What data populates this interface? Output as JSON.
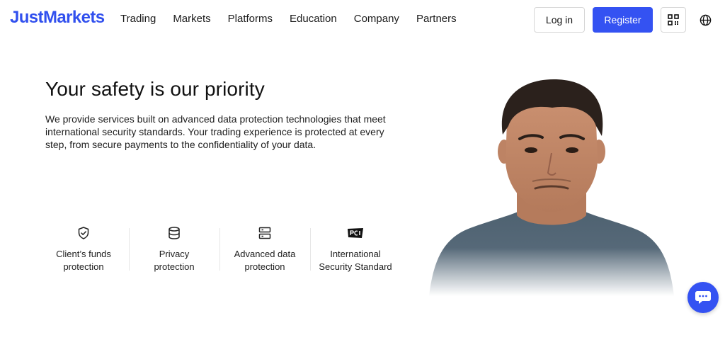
{
  "header": {
    "logo": "JustMarkets",
    "nav": [
      "Trading",
      "Markets",
      "Platforms",
      "Education",
      "Company",
      "Partners"
    ],
    "login_label": "Log in",
    "register_label": "Register",
    "brand_color": "#3452f2"
  },
  "hero": {
    "title": "Your safety is our priority",
    "description": "We provide services built on advanced data protection technologies that meet international security standards. Your trading experience is protected at every step, from secure payments to the confidentiality of your data."
  },
  "features": [
    {
      "icon": "shield-check-icon",
      "label": "Client’s funds\nprotection"
    },
    {
      "icon": "database-icon",
      "label": "Privacy\nprotection"
    },
    {
      "icon": "server-icon",
      "label": "Advanced data\nprotection"
    },
    {
      "icon": "pci-icon",
      "label": "International\nSecurity Standard"
    }
  ],
  "icons": {
    "qr": "qr-code-icon",
    "language": "globe-icon",
    "chat": "chat-bubble-icon"
  }
}
